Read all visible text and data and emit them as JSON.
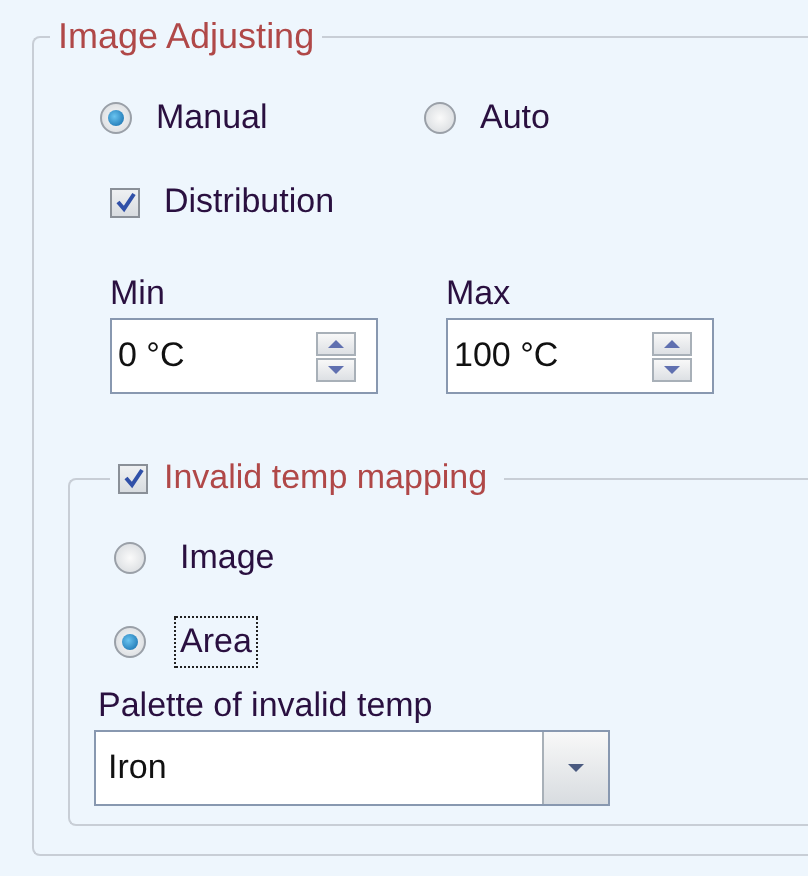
{
  "group": {
    "title": "Image Adjusting"
  },
  "mode_options": [
    {
      "label": "Manual",
      "selected": true
    },
    {
      "label": "Auto",
      "selected": false
    }
  ],
  "distribution": {
    "label": "Distribution",
    "checked": true
  },
  "range": [
    {
      "label": "Min",
      "value": "0 °C"
    },
    {
      "label": "Max",
      "value": "100 °C"
    }
  ],
  "invalid_mapping": {
    "label": "Invalid temp mapping",
    "checked": true,
    "options": [
      {
        "label": "Image",
        "selected": false,
        "focused": false
      },
      {
        "label": "Area",
        "selected": true,
        "focused": true
      }
    ],
    "palette": {
      "label": "Palette of invalid temp",
      "value": "Iron"
    }
  }
}
